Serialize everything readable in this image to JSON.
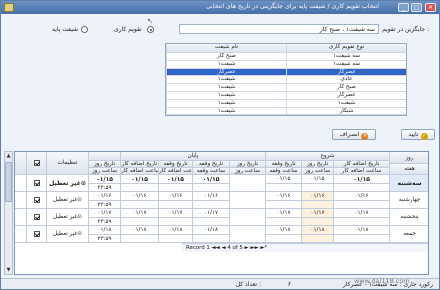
{
  "window": {
    "title": "انتخاب تقویم کاری / شیفت پایه برای جایگزینی در تاریخ های انتخابی"
  },
  "form": {
    "replace_label": "جایگزین در تقویم :",
    "replace_value": "سه شیفت۱ ، صبح کار",
    "radio_calendar": "تقویم کاری",
    "radio_base_shift": "شیفت پایه",
    "selected_radio": "calendar"
  },
  "shift_list": {
    "headers": [
      "نوع تقویم کاری",
      "نام شیفت"
    ],
    "rows": [
      [
        "سه شیفت۱",
        "صبح کار"
      ],
      [
        "سه شیفت۱",
        "شیفت۱"
      ],
      [
        "عصرکار",
        "عصرکار"
      ],
      [
        "عادی",
        "شیفت۱"
      ],
      [
        "صبح کار",
        "شیفت۱"
      ],
      [
        "عصرکار",
        "شیفت۱"
      ],
      [
        "شیفت۱",
        "شیفت۱"
      ],
      [
        "شبکار",
        "شیفت۱"
      ]
    ],
    "selected_index": 2
  },
  "actions": {
    "confirm": "تایید",
    "cancel": "انصراف"
  },
  "grid": {
    "day_header": "روز",
    "week_header": "هفته",
    "group_start": "شروع",
    "group_end": "پایان",
    "settings_header": "تنظیمات",
    "col_date_overtime": "تاریخ اضافه کار",
    "col_time_overtime": "ساعت اضافه کار",
    "col_date_break": "تاریخ وقفه",
    "col_time_break": "ساعت وقفه",
    "col_date_day": "تاریخ روز",
    "col_time_day": "ساعت روز",
    "rows": [
      {
        "day": "سه‌شنبه",
        "start": [
          "۰۱/۱۵",
          "۰۱/۱۵",
          "۰۱/۱۵"
        ],
        "end": [
          "۰۱/۱۵",
          "۰۱/۱۵",
          "۰۱/۱۵"
        ],
        "day_date": "۰۱/۱۵",
        "day_time": "۲۳:۵۹",
        "status": "غیر تعطیل"
      },
      {
        "day": "چهارشنبه",
        "start": [
          "۰۱/۱۶",
          "۰۱/۱۶",
          "۰۱/۱۶"
        ],
        "end": [
          "۰۱/۱۶",
          "۰۱/۱۶",
          "۰۱/۱۶"
        ],
        "day_date": "۰۱/۱۶",
        "day_time": "۲۳:۵۹",
        "status": "غیر تعطیل"
      },
      {
        "day": "پنجشنبه",
        "start": [
          "۰۱/۱۷",
          "۰۱/۱۷",
          "۰۱/۱۷"
        ],
        "end": [
          "۰۱/۱۷",
          "۰۱/۱۷",
          "۰۱/۱۷"
        ],
        "day_date": "۰۱/۱۷",
        "day_time": "۲۳:۵۹",
        "status": "غیر تعطیل"
      },
      {
        "day": "جمعه",
        "start": [
          "۰۱/۱۸",
          "۰۱/۱۸",
          "۰۱/۱۸"
        ],
        "end": [
          "۰۱/۱۸",
          "۰۱/۱۸",
          "۰۱/۱۸"
        ],
        "day_date": "۰۱/۱۸",
        "day_time": "۲۳:۵۹",
        "status": "غیر تعطیل"
      }
    ]
  },
  "navigator": {
    "text": "Record 1  ◄◄  ◄  4 of 5  ►  ►►  ►*"
  },
  "status": {
    "count_label": "تعداد کل :",
    "count_value": "۶",
    "current_label": "رکورد جاری : سه شیفت۱ - عصرکار"
  },
  "watermark": "www.dal118.com"
}
